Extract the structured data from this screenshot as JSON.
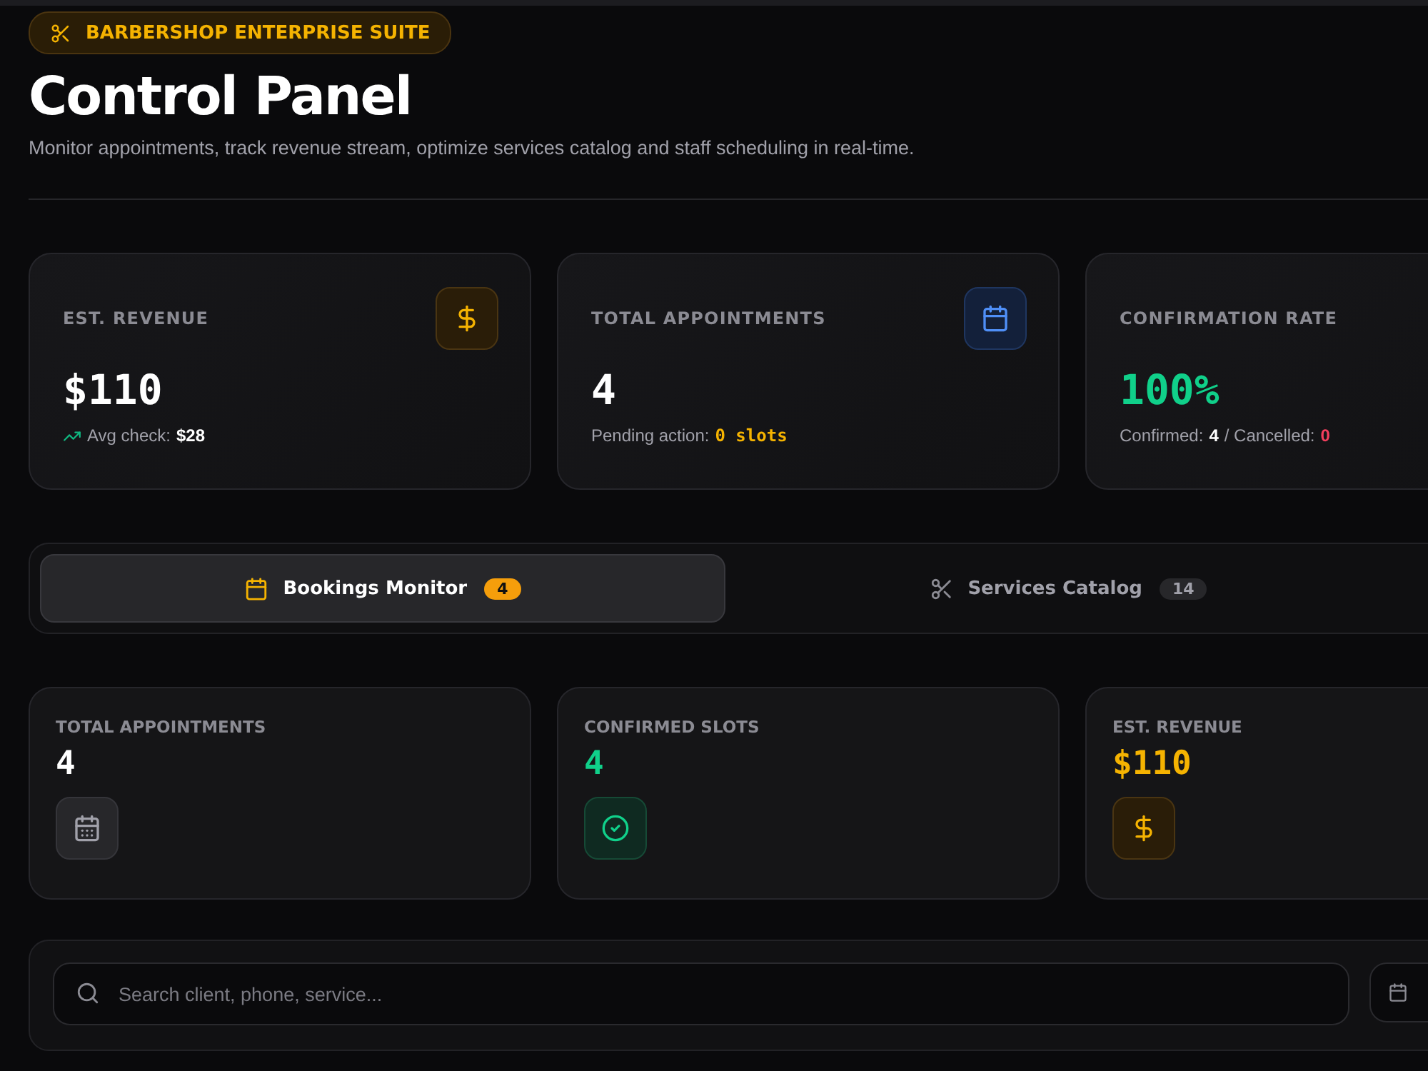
{
  "header": {
    "badge": "BARBERSHOP ENTERPRISE SUITE",
    "title": "Control Panel",
    "subtitle": "Monitor appointments, track revenue stream, optimize services catalog and staff scheduling in real-time."
  },
  "kpis": [
    {
      "kind": "revenue",
      "label": "EST. REVENUE",
      "value": "$110",
      "note": [
        {
          "kind": "trend",
          "text": "Avg check:"
        },
        {
          "kind": "strong",
          "text": "$28"
        }
      ]
    },
    {
      "kind": "appointments",
      "label": "TOTAL APPOINTMENTS",
      "value": "4",
      "note": [
        {
          "kind": "label",
          "text": "Pending action:"
        },
        {
          "kind": "pending",
          "text": "0 slots"
        }
      ]
    },
    {
      "kind": "rate",
      "label": "CONFIRMATION RATE",
      "value": "100%",
      "note": [
        {
          "kind": "label",
          "text": "Confirmed:"
        },
        {
          "kind": "strong",
          "text": "4"
        },
        {
          "kind": "label",
          "text": "/ Cancelled:"
        },
        {
          "kind": "alert",
          "text": "0"
        }
      ]
    }
  ],
  "tabs": [
    {
      "kind": "bookings",
      "label": "Bookings Monitor",
      "count": "4",
      "selected": true
    },
    {
      "kind": "services",
      "label": "Services Catalog",
      "count": "14",
      "selected": false
    }
  ],
  "summary": [
    {
      "kind": "total",
      "label": "TOTAL APPOINTMENTS",
      "value": "4"
    },
    {
      "kind": "confirmed",
      "label": "CONFIRMED SLOTS",
      "value": "4"
    },
    {
      "kind": "revenue",
      "label": "EST. REVENUE",
      "value": "$110"
    }
  ],
  "filters": {
    "search": {
      "placeholder": "Search client, phone, service..."
    }
  }
}
